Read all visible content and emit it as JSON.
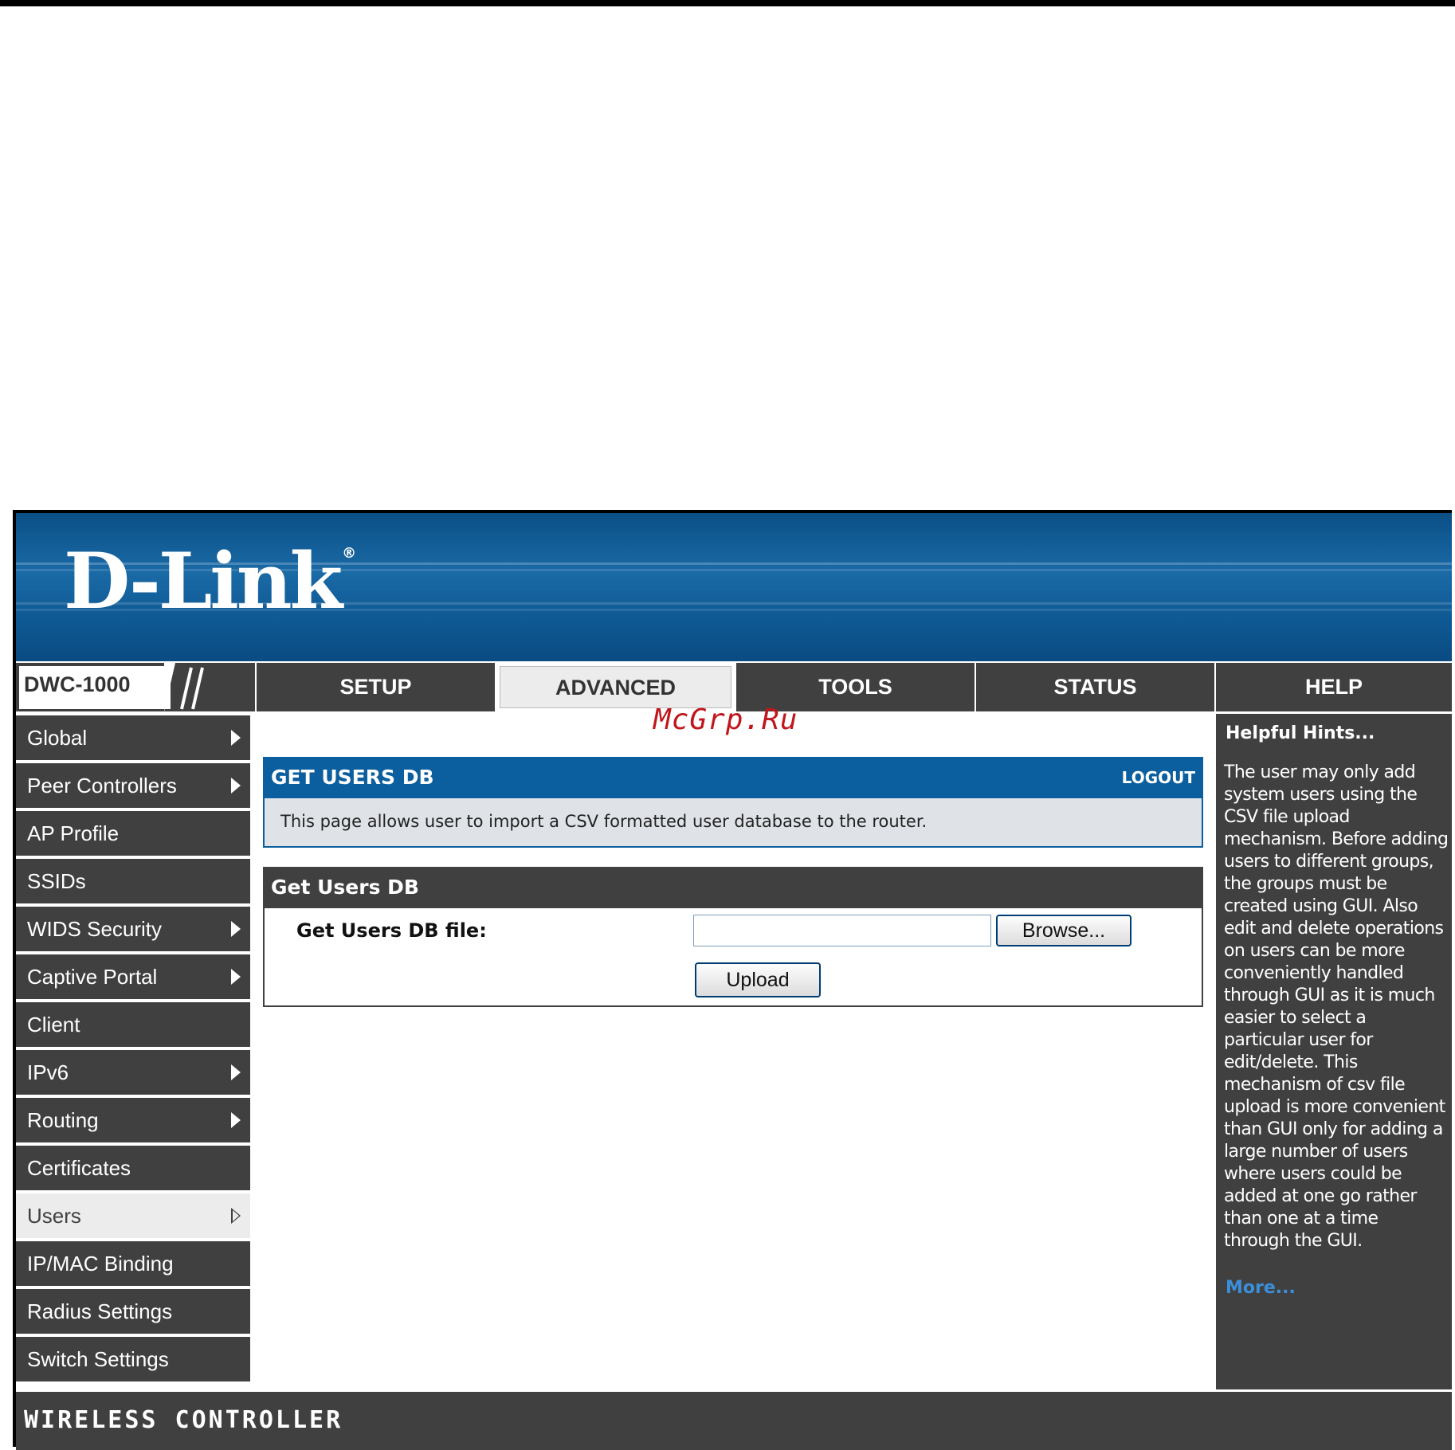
{
  "brand": {
    "logo_text": "D-Link",
    "registered_mark": "®",
    "model": "DWC-1000"
  },
  "nav": {
    "tabs": [
      {
        "label": "SETUP",
        "active": false
      },
      {
        "label": "ADVANCED",
        "active": true
      },
      {
        "label": "TOOLS",
        "active": false
      },
      {
        "label": "STATUS",
        "active": false
      },
      {
        "label": "HELP",
        "active": false
      }
    ]
  },
  "sidebar": {
    "items": [
      {
        "label": "Global",
        "has_submenu": true
      },
      {
        "label": "Peer Controllers",
        "has_submenu": true
      },
      {
        "label": "AP Profile",
        "has_submenu": false
      },
      {
        "label": "SSIDs",
        "has_submenu": false
      },
      {
        "label": "WIDS Security",
        "has_submenu": true
      },
      {
        "label": "Captive Portal",
        "has_submenu": true
      },
      {
        "label": "Client",
        "has_submenu": false
      },
      {
        "label": "IPv6",
        "has_submenu": true
      },
      {
        "label": "Routing",
        "has_submenu": true
      },
      {
        "label": "Certificates",
        "has_submenu": false
      },
      {
        "label": "Users",
        "has_submenu": true,
        "active": true
      },
      {
        "label": "IP/MAC Binding",
        "has_submenu": false
      },
      {
        "label": "Radius Settings",
        "has_submenu": false
      },
      {
        "label": "Switch Settings",
        "has_submenu": false
      }
    ]
  },
  "watermark": "McGrp.Ru",
  "main": {
    "panel_title": "GET USERS DB",
    "logout_label": "LOGOUT",
    "description": "This page allows user to import a CSV formatted user database to the router.",
    "section_title": "Get Users DB",
    "field_label": "Get Users DB file:",
    "file_value": "",
    "browse_label": "Browse...",
    "upload_label": "Upload"
  },
  "help": {
    "title": "Helpful Hints...",
    "text": "The user may only add system users using the CSV file upload mechanism. Before adding users to different groups, the groups must be created using GUI. Also edit and delete operations on users can be more conveniently handled through GUI as it is much easier to select a particular user for edit/delete. This mechanism of csv file upload is more convenient than GUI only for adding a large number of users where users could be added at one go rather than one at a time through the GUI.",
    "more_label": "More..."
  },
  "footer": {
    "text": "WIRELESS CONTROLLER"
  },
  "colors": {
    "nav_bg": "#404040",
    "panel_blue": "#0b5f9e",
    "link_blue": "#3b8fd9",
    "watermark_red": "#c0161c"
  }
}
